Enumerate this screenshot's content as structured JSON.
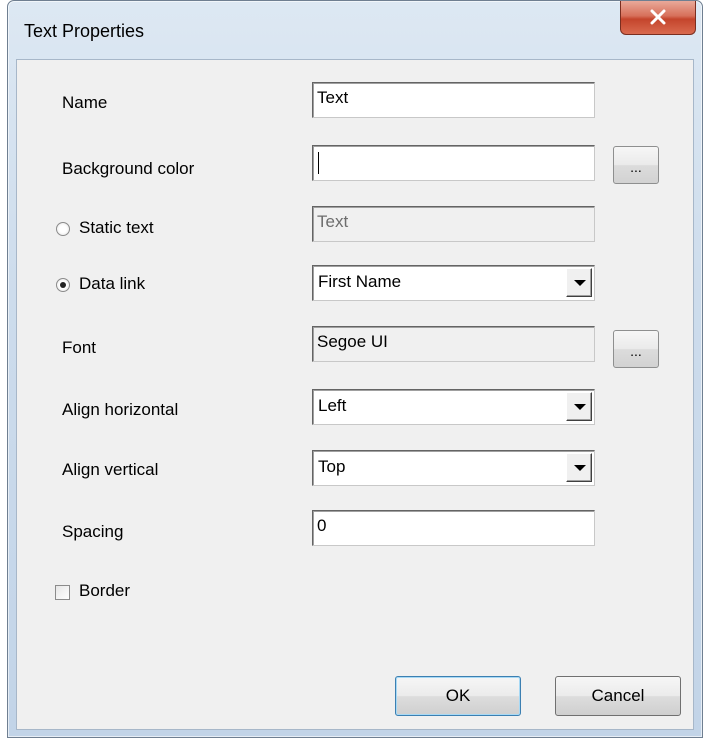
{
  "window": {
    "title": "Text Properties",
    "close_icon": "close-icon"
  },
  "form": {
    "name": {
      "label": "Name",
      "value": "Text"
    },
    "background_color": {
      "label": "Background color",
      "value": "",
      "button": "..."
    },
    "static_text": {
      "label": "Static text",
      "value": "Text",
      "selected": false
    },
    "data_link": {
      "label": "Data link",
      "value": "First Name",
      "selected": true
    },
    "font": {
      "label": "Font",
      "value": "Segoe UI",
      "button": "..."
    },
    "align_horizontal": {
      "label": "Align horizontal",
      "value": "Left"
    },
    "align_vertical": {
      "label": "Align vertical",
      "value": "Top"
    },
    "spacing": {
      "label": "Spacing",
      "value": "0"
    },
    "border": {
      "label": "Border",
      "checked": false
    }
  },
  "buttons": {
    "ok": "OK",
    "cancel": "Cancel"
  },
  "colors": {
    "dialog_bg": "#f0f0f0",
    "close_button": "#c4452c",
    "default_button_border": "#3c7fb1"
  }
}
